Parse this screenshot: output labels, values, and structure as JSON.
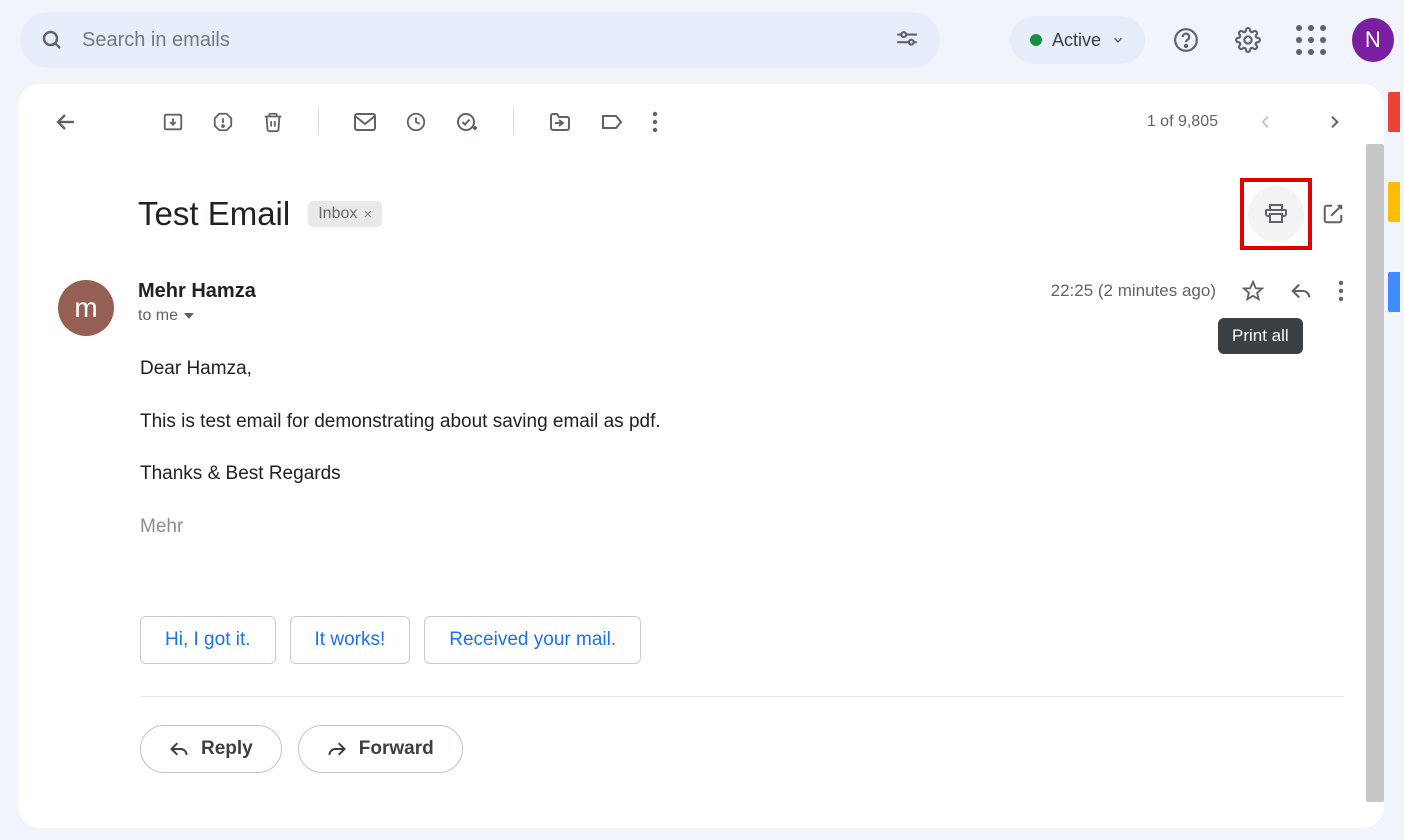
{
  "search": {
    "placeholder": "Search in emails"
  },
  "status": {
    "label": "Active"
  },
  "pager": {
    "text": "1 of 9,805"
  },
  "subject": "Test Email",
  "folder_label": "Inbox",
  "sender": {
    "name": "Mehr Hamza",
    "initial": "m",
    "to_line": "to me"
  },
  "time": "22:25 (2 minutes ago)",
  "body": {
    "greeting": "Dear Hamza,",
    "line1": "This is test email for demonstrating about saving email as pdf.",
    "closing": "Thanks & Best Regards",
    "signature": "Mehr"
  },
  "smart_replies": [
    "Hi, I got it.",
    "It works!",
    "Received your mail."
  ],
  "actions": {
    "reply": "Reply",
    "forward": "Forward"
  },
  "tooltip": "Print all",
  "profile_initial": "N"
}
